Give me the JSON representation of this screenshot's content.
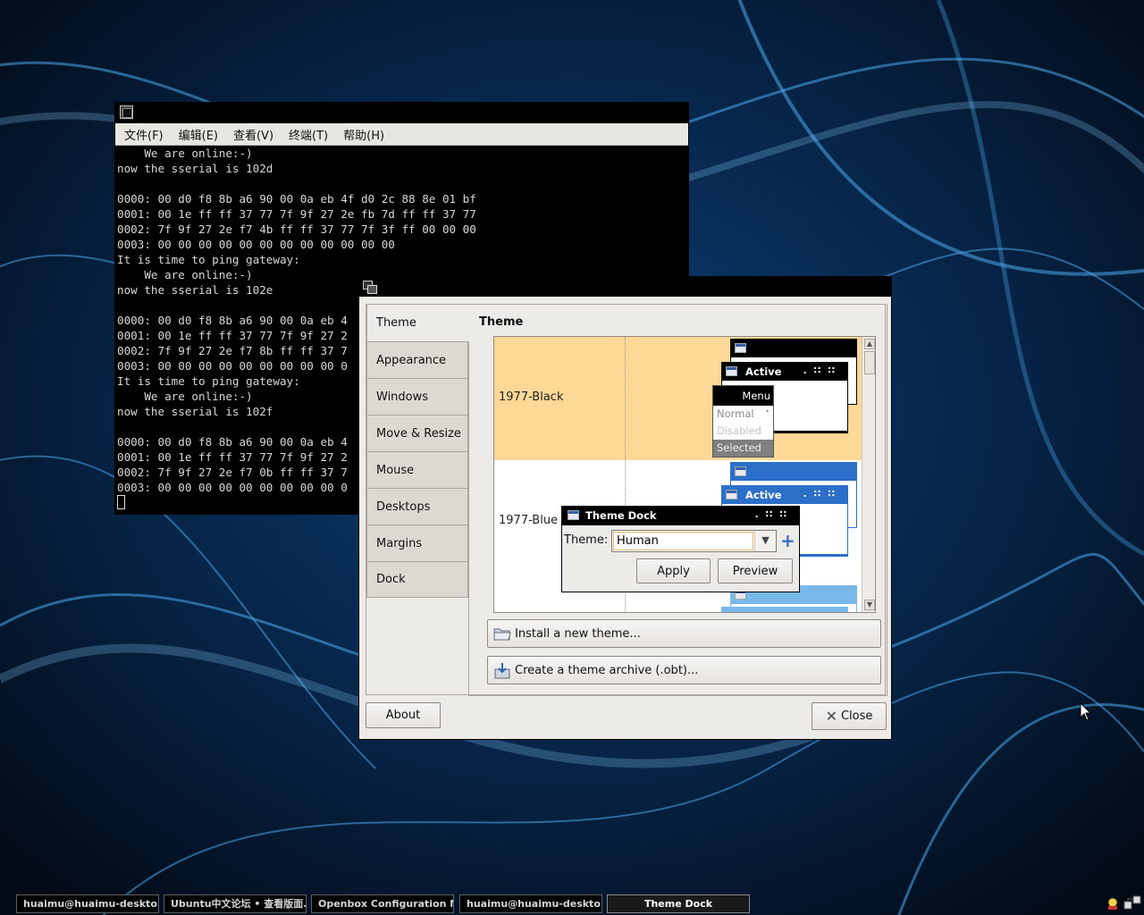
{
  "terminal": {
    "menu": [
      "文件(F)",
      "编辑(E)",
      "查看(V)",
      "终端(T)",
      "帮助(H)"
    ],
    "lines": [
      "    We are online:-)",
      "now the sserial is 102d",
      "",
      "0000: 00 d0 f8 8b a6 90 00 0a eb 4f d0 2c 88 8e 01 bf",
      "0001: 00 1e ff ff 37 77 7f 9f 27 2e fb 7d ff ff 37 77",
      "0002: 7f 9f 27 2e f7 4b ff ff 37 77 7f 3f ff 00 00 00",
      "0003: 00 00 00 00 00 00 00 00 00 00 00 00",
      "It is time to ping gateway:",
      "    We are online:-)",
      "now the sserial is 102e",
      "",
      "0000: 00 d0 f8 8b a6 90 00 0a eb 4",
      "0001: 00 1e ff ff 37 77 7f 9f 27 2",
      "0002: 7f 9f 27 2e f7 8b ff ff 37 7",
      "0003: 00 00 00 00 00 00 00 00 00 0",
      "It is time to ping gateway:",
      "    We are online:-)",
      "now the sserial is 102f",
      "",
      "0000: 00 d0 f8 8b a6 90 00 0a eb 4",
      "0001: 00 1e ff ff 37 77 7f 9f 27 2",
      "0002: 7f 9f 27 2e f7 0b ff ff 37 7",
      "0003: 00 00 00 00 00 00 00 00 00 0"
    ]
  },
  "obconf": {
    "tabs": [
      "Theme",
      "Appearance",
      "Windows",
      "Move & Resize",
      "Mouse",
      "Desktops",
      "Margins",
      "Dock"
    ],
    "active_tab": "Theme",
    "heading": "Theme",
    "themes": [
      {
        "name": "1977-Black",
        "selected": true
      },
      {
        "name": "1977-Blue",
        "selected": false
      }
    ],
    "preview_active_label": "Active",
    "preview_menu": {
      "title": "Menu",
      "normal": "Normal",
      "disabled": "Disabled",
      "selected": "Selected"
    },
    "install_button": "Install a new theme...",
    "archive_button": "Create a theme archive (.obt)...",
    "about_button": "About",
    "close_button": "Close"
  },
  "theme_dock": {
    "title": "Theme Dock",
    "theme_label": "Theme:",
    "theme_value": "Human",
    "apply_button": "Apply",
    "preview_button": "Preview"
  },
  "taskbar": {
    "tasks": [
      "huaimu@huaimu-deskto...",
      "Ubuntu中文论坛 • 查看版面...",
      "Openbox Configuration M...",
      "huaimu@huaimu-deskto...",
      "Theme Dock"
    ],
    "active_task": "Theme Dock"
  },
  "colors": {
    "selected_row": "#fdd896",
    "preview_blue": "#2b6fc9",
    "preview_light_blue": "#7ab8ea"
  }
}
